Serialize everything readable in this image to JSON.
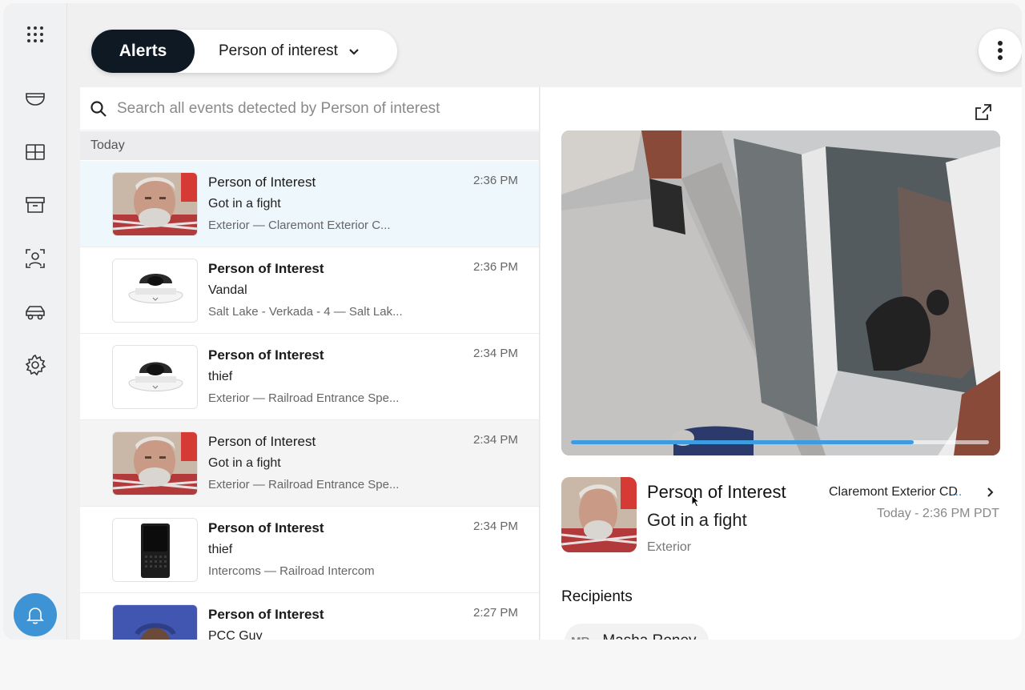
{
  "header": {
    "active_tab": "Alerts",
    "filter_label": "Person of interest"
  },
  "search": {
    "placeholder": "Search all events detected by Person of interest"
  },
  "list": {
    "group_label": "Today",
    "items": [
      {
        "title": "Person of Interest",
        "subtitle": "Got in a fight",
        "location": "Exterior — Claremont Exterior C...",
        "time": "2:36 PM",
        "thumb": "face"
      },
      {
        "title": "Person of Interest",
        "subtitle": "Vandal",
        "location": "Salt Lake - Verkada - 4 — Salt Lak...",
        "time": "2:36 PM",
        "thumb": "dome-camera"
      },
      {
        "title": "Person of Interest",
        "subtitle": "thief",
        "location": "Exterior — Railroad Entrance Spe...",
        "time": "2:34 PM",
        "thumb": "dome-camera"
      },
      {
        "title": "Person of Interest",
        "subtitle": "Got in a fight",
        "location": "Exterior — Railroad Entrance Spe...",
        "time": "2:34 PM",
        "thumb": "face"
      },
      {
        "title": "Person of Interest",
        "subtitle": "thief",
        "location": "Intercoms — Railroad Intercom",
        "time": "2:34 PM",
        "thumb": "intercom"
      },
      {
        "title": "Person of Interest",
        "subtitle": "PCC Guy",
        "location": "",
        "time": "2:27 PM",
        "thumb": "face-hood"
      }
    ]
  },
  "detail": {
    "title": "Person of Interest",
    "subtitle": "Got in a fight",
    "location": "Exterior",
    "camera": "Claremont Exterior CD",
    "camera_ellipsis": "...",
    "timestamp": "Today - 2:36 PM PDT",
    "playback_progress": 0.82,
    "recipients_label": "Recipients",
    "recipients": [
      {
        "initials": "MR",
        "name": "Masha Roney"
      }
    ]
  },
  "colors": {
    "accent": "#3d93d4",
    "dark_pill": "#0f1923",
    "selected_row": "#eef7fc"
  },
  "icons": {
    "rail": [
      "apps-grid-icon",
      "dome-camera-icon",
      "grid-layout-icon",
      "archive-icon",
      "person-of-interest-icon",
      "vehicle-icon",
      "gear-icon",
      "bell-icon"
    ]
  }
}
